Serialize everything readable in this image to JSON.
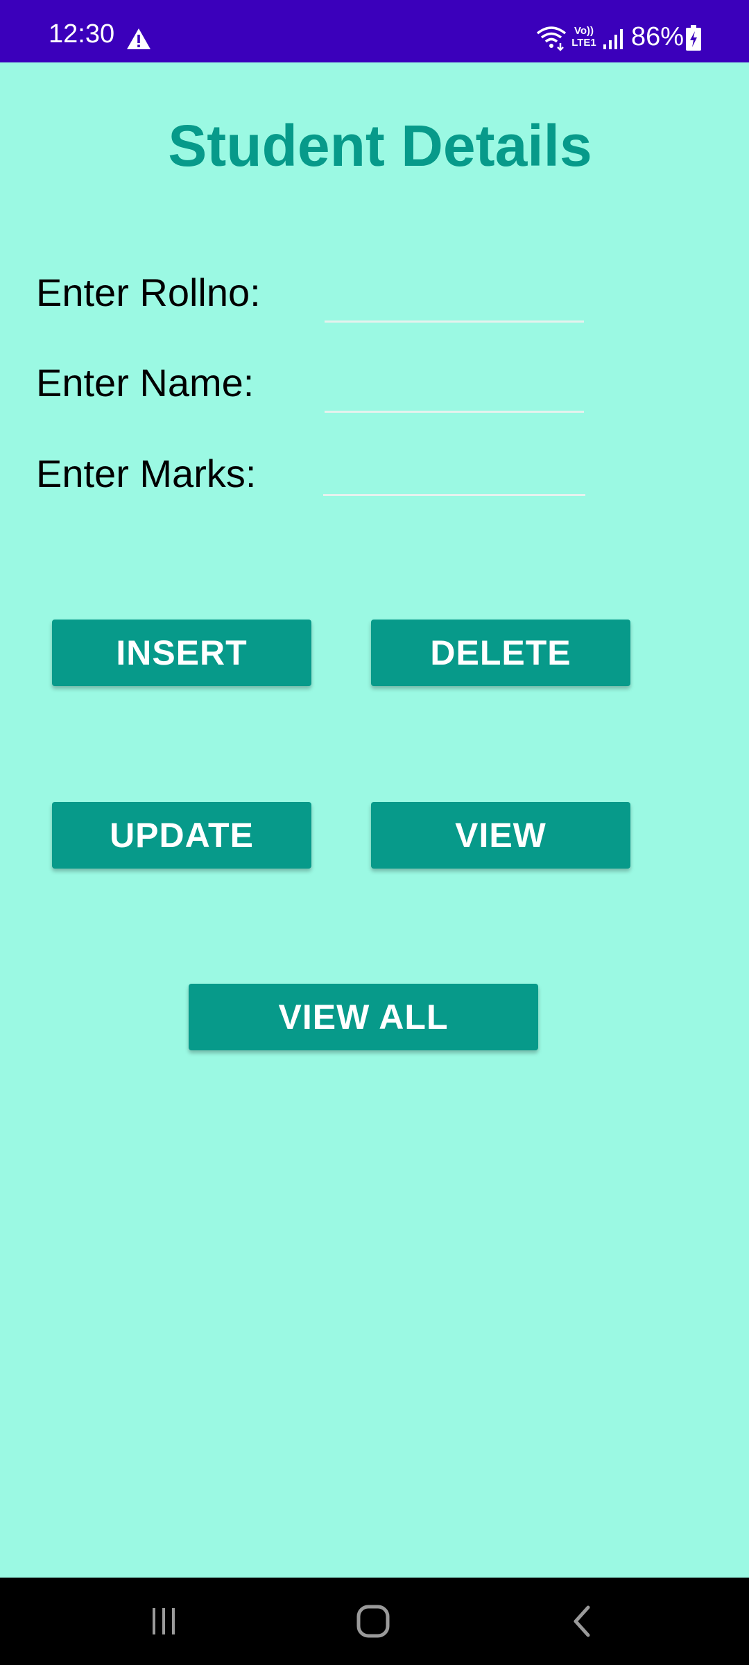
{
  "status_bar": {
    "time": "12:30",
    "network_label": "Vo)) LTE1",
    "battery": "86%",
    "icons": [
      "warning-icon",
      "wifi-icon",
      "signal-icon",
      "battery-charging-icon"
    ]
  },
  "title": "Student Details",
  "form": {
    "rollno_label": "Enter Rollno:",
    "rollno_value": "",
    "name_label": "Enter Name:",
    "name_value": "",
    "marks_label": "Enter Marks:",
    "marks_value": ""
  },
  "buttons": {
    "insert": "INSERT",
    "delete": "DELETE",
    "update": "UPDATE",
    "view": "VIEW",
    "view_all": "VIEW ALL"
  },
  "nav_bar": {
    "icons": [
      "recent-apps-icon",
      "home-icon",
      "back-icon"
    ]
  },
  "colors": {
    "status_bar": "#3b00bb",
    "background": "#9bf9e3",
    "accent": "#079a8a",
    "nav_bar": "#000000"
  }
}
